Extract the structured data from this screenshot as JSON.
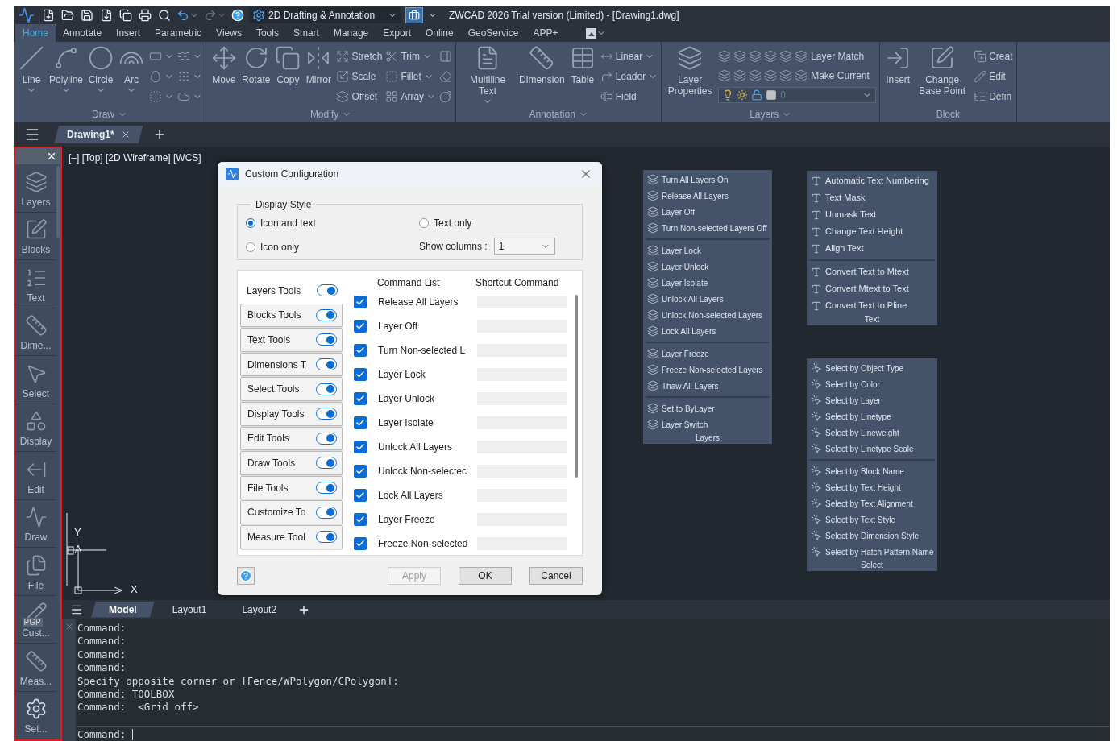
{
  "title_bar": {
    "workspace": "2D Drafting & Annotation",
    "title": "ZWCAD 2026 Trial version (Limited) - [Drawing1.dwg]"
  },
  "menu_tabs": [
    {
      "label": "Home",
      "selected": true
    },
    {
      "label": "Annotate",
      "selected": false
    },
    {
      "label": "Insert",
      "selected": false
    },
    {
      "label": "Parametric",
      "selected": false
    },
    {
      "label": "Views",
      "selected": false
    },
    {
      "label": "Tools",
      "selected": false
    },
    {
      "label": "Smart",
      "selected": false
    },
    {
      "label": "Manage",
      "selected": false
    },
    {
      "label": "Export",
      "selected": false
    },
    {
      "label": "Online",
      "selected": false
    },
    {
      "label": "GeoService",
      "selected": false
    },
    {
      "label": "APP+",
      "selected": false
    }
  ],
  "ribbon": [
    {
      "kind": "standard",
      "title": "Draw",
      "menu": true,
      "large": [
        {
          "label": "Line",
          "dropdown": true
        },
        {
          "label": "Polyline",
          "dropdown": true
        },
        {
          "label": "Circle",
          "dropdown": true
        },
        {
          "label": "Arc",
          "dropdown": true
        }
      ],
      "small_columns": [
        [
          {
            "dropdown": true
          },
          {
            "dropdown": true
          },
          {
            "dropdown": true
          }
        ],
        [
          {
            "dropdown": true
          },
          {
            "dropdown": true
          },
          {
            "dropdown": true
          }
        ]
      ]
    },
    {
      "kind": "standard",
      "title": "Modify",
      "menu": true,
      "large": [
        {
          "label": "Move",
          "dropdown": false
        },
        {
          "label": "Rotate",
          "dropdown": false
        },
        {
          "label": "Copy",
          "dropdown": false
        },
        {
          "label": "Mirror",
          "dropdown": false
        }
      ],
      "small_columns": [
        [
          {
            "label": "Stretch",
            "dropdown": false
          },
          {
            "label": "Scale",
            "dropdown": false
          },
          {
            "label": "Offset",
            "dropdown": false
          }
        ],
        [
          {
            "label": "Trim",
            "dropdown": true
          },
          {
            "label": "Fillet",
            "dropdown": true
          },
          {
            "label": "Array",
            "dropdown": true
          }
        ],
        [
          {
            "dropdown": false
          },
          {
            "dropdown": false
          },
          {
            "dropdown": false
          }
        ]
      ]
    },
    {
      "kind": "standard",
      "title": "Annotation",
      "menu": true,
      "large": [
        {
          "label": "Multiline Text",
          "dropdown": true
        },
        {
          "label": "Dimension",
          "dropdown": false
        },
        {
          "label": "Table",
          "dropdown": false
        }
      ],
      "small_columns": [
        [
          {
            "label": "Linear",
            "dropdown": true
          },
          {
            "label": "Leader",
            "dropdown": true
          },
          {
            "label": "Field",
            "dropdown": false
          }
        ]
      ]
    },
    {
      "kind": "layers",
      "title": "Layers",
      "menu": true,
      "large": [
        {
          "label": "Layer Properties",
          "dropdown": false
        }
      ],
      "rows": [
        {
          "label": "Layer Match"
        },
        {
          "label": "Make Current"
        }
      ],
      "layer_select": {
        "value": "0"
      }
    },
    {
      "kind": "standard",
      "title": "Block",
      "menu": false,
      "large": [
        {
          "label": "Insert",
          "dropdown": false
        },
        {
          "label": "Change Base Point",
          "dropdown": false
        }
      ],
      "small_columns": [
        [
          {
            "label": "Creat",
            "dropdown": false
          },
          {
            "label": "Edit",
            "dropdown": false
          },
          {
            "label": "Defin",
            "dropdown": false
          }
        ]
      ]
    }
  ],
  "doc_tabs": [
    {
      "label": "Drawing1*",
      "selected": true
    }
  ],
  "toolbox": {
    "items": [
      {
        "label": "Layers"
      },
      {
        "label": "Blocks"
      },
      {
        "label": "Text"
      },
      {
        "label": "Dime..."
      },
      {
        "label": "Select"
      },
      {
        "label": "Display"
      },
      {
        "label": "Edit"
      },
      {
        "label": "Draw"
      },
      {
        "label": "File"
      },
      {
        "label": "Cust...",
        "badge": "PGP"
      },
      {
        "label": "Meas..."
      },
      {
        "label": "Set..."
      }
    ]
  },
  "viewport": {
    "label": "[–] [Top] [2D Wireframe] [WCS]",
    "ucs_y": "Y",
    "ucs_x": "X"
  },
  "dialog": {
    "title": "Custom Configuration",
    "group": "Display Style",
    "radios": [
      {
        "label": "Icon and text",
        "selected": true
      },
      {
        "label": "Text only",
        "selected": false
      },
      {
        "label": "Icon only",
        "selected": false
      }
    ],
    "columns_label": "Show columns :",
    "columns_value": "1",
    "tools": [
      {
        "label": "Layers Tools",
        "on": true,
        "selected": true
      },
      {
        "label": "Blocks Tools",
        "on": true,
        "selected": false
      },
      {
        "label": "Text Tools",
        "on": true,
        "selected": false
      },
      {
        "label": "Dimensions T",
        "on": true,
        "selected": false
      },
      {
        "label": "Select Tools",
        "on": true,
        "selected": false
      },
      {
        "label": "Display Tools",
        "on": true,
        "selected": false
      },
      {
        "label": "Edit Tools",
        "on": true,
        "selected": false
      },
      {
        "label": "Draw Tools",
        "on": true,
        "selected": false
      },
      {
        "label": "File Tools",
        "on": true,
        "selected": false
      },
      {
        "label": "Customize To",
        "on": true,
        "selected": false
      },
      {
        "label": "Measure Tool",
        "on": true,
        "selected": false
      }
    ],
    "headers": [
      "Command List",
      "Shortcut Command"
    ],
    "commands": [
      {
        "label": "Release All Layers",
        "checked": true
      },
      {
        "label": "Layer Off",
        "checked": true
      },
      {
        "label": "Turn Non-selected L",
        "checked": true
      },
      {
        "label": "Layer Lock",
        "checked": true
      },
      {
        "label": "Layer Unlock",
        "checked": true
      },
      {
        "label": "Layer Isolate",
        "checked": true
      },
      {
        "label": "Unlock All Layers",
        "checked": true
      },
      {
        "label": "Unlock Non-selectec",
        "checked": true
      },
      {
        "label": "Lock All Layers",
        "checked": true
      },
      {
        "label": "Layer Freeze",
        "checked": true
      },
      {
        "label": "Freeze Non-selected",
        "checked": true
      }
    ],
    "buttons": [
      {
        "label": "Apply",
        "disabled": true
      },
      {
        "label": "OK",
        "disabled": false
      },
      {
        "label": "Cancel",
        "disabled": false
      }
    ]
  },
  "panels": [
    {
      "kind": "layers",
      "title": "Layers",
      "groups": [
        [
          "Turn All Layers On",
          "Release All Layers",
          "Layer Off",
          "Turn Non-selected Layers Off"
        ],
        [
          "Layer Lock",
          "Layer Unlock",
          "Layer Isolate",
          "Unlock All Layers",
          "Unlock Non-selected Layers",
          "Lock All Layers"
        ],
        [
          "Layer Freeze",
          "Freeze Non-selected Layers",
          "Thaw All Layers"
        ],
        [
          "Set to ByLayer",
          "Layer Switch"
        ]
      ]
    },
    {
      "kind": "text",
      "title": "Text",
      "groups": [
        [
          "Automatic Text Numbering",
          "Text Mask",
          "Unmask Text",
          "Change Text Height",
          "Align Text"
        ],
        [
          "Convert Text to Mtext",
          "Convert Mtext to Text",
          "Convert Text to Pline"
        ]
      ]
    },
    {
      "kind": "select",
      "title": "Select",
      "groups": [
        [
          "Select by Object Type",
          "Select by Color",
          "Select by Layer",
          "Select by Linetype",
          "Select by Lineweight",
          "Select by Linetype Scale"
        ],
        [
          "Select by Block Name",
          "Select by Text Height",
          "Select by Text Alignment",
          "Select by Text Style",
          "Select by Dimension Style",
          "Select by Hatch Pattern Name"
        ]
      ]
    }
  ],
  "layout_tabs": [
    {
      "label": "Model",
      "selected": true
    },
    {
      "label": "Layout1",
      "selected": false
    },
    {
      "label": "Layout2",
      "selected": false
    }
  ],
  "command": {
    "lines": [
      "Command:",
      "Command:",
      "Command:",
      "Command:",
      "Specify opposite corner or [Fence/WPolygon/CPolygon]:",
      "Command: TOOLBOX",
      "Command:  <Grid off>"
    ],
    "prompt": "Command:"
  }
}
